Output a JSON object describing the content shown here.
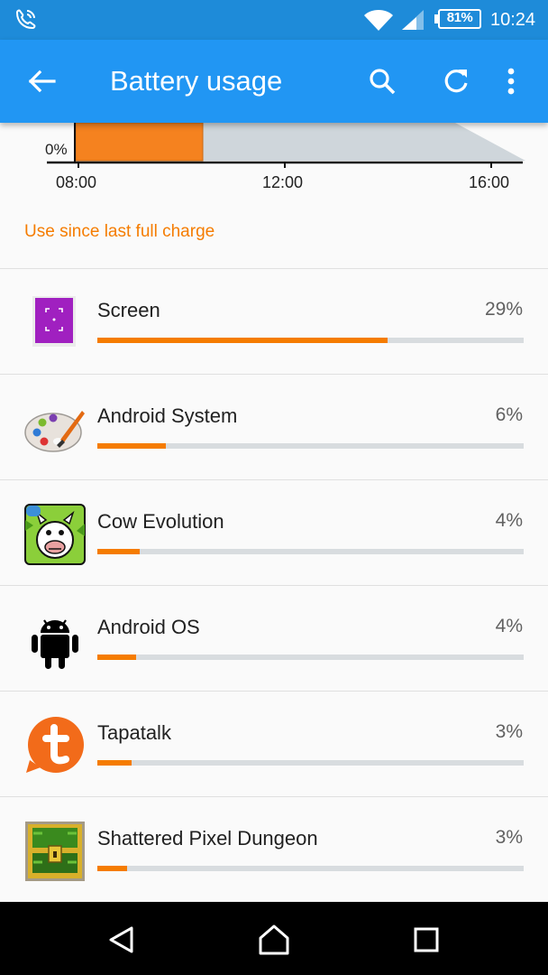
{
  "status_bar": {
    "battery_percent": "81%",
    "time": "10:24"
  },
  "app_bar": {
    "title": "Battery usage"
  },
  "chart_data": {
    "type": "area",
    "y_min_label": "0%",
    "x_ticks": [
      "08:00",
      "12:00",
      "16:00"
    ]
  },
  "section_label": "Use since last full charge",
  "apps": [
    {
      "name": "Screen",
      "percent_label": "29%",
      "bar_fraction": 0.68
    },
    {
      "name": "Android System",
      "percent_label": "6%",
      "bar_fraction": 0.16
    },
    {
      "name": "Cow Evolution",
      "percent_label": "4%",
      "bar_fraction": 0.1
    },
    {
      "name": "Android OS",
      "percent_label": "4%",
      "bar_fraction": 0.09
    },
    {
      "name": "Tapatalk",
      "percent_label": "3%",
      "bar_fraction": 0.08
    },
    {
      "name": "Shattered Pixel Dungeon",
      "percent_label": "3%",
      "bar_fraction": 0.07
    }
  ],
  "colors": {
    "status_bar": "#1e8bd9",
    "app_bar": "#2196f3",
    "accent": "#f57c00",
    "track": "#d8dcdf"
  },
  "icons": {
    "status": [
      "phone-call-icon",
      "wifi-icon",
      "signal-icon",
      "battery-icon"
    ],
    "app_bar": [
      "back-arrow-icon",
      "search-icon",
      "refresh-icon",
      "more-vert-icon"
    ],
    "nav": [
      "nav-back-icon",
      "nav-home-icon",
      "nav-recents-icon"
    ]
  }
}
